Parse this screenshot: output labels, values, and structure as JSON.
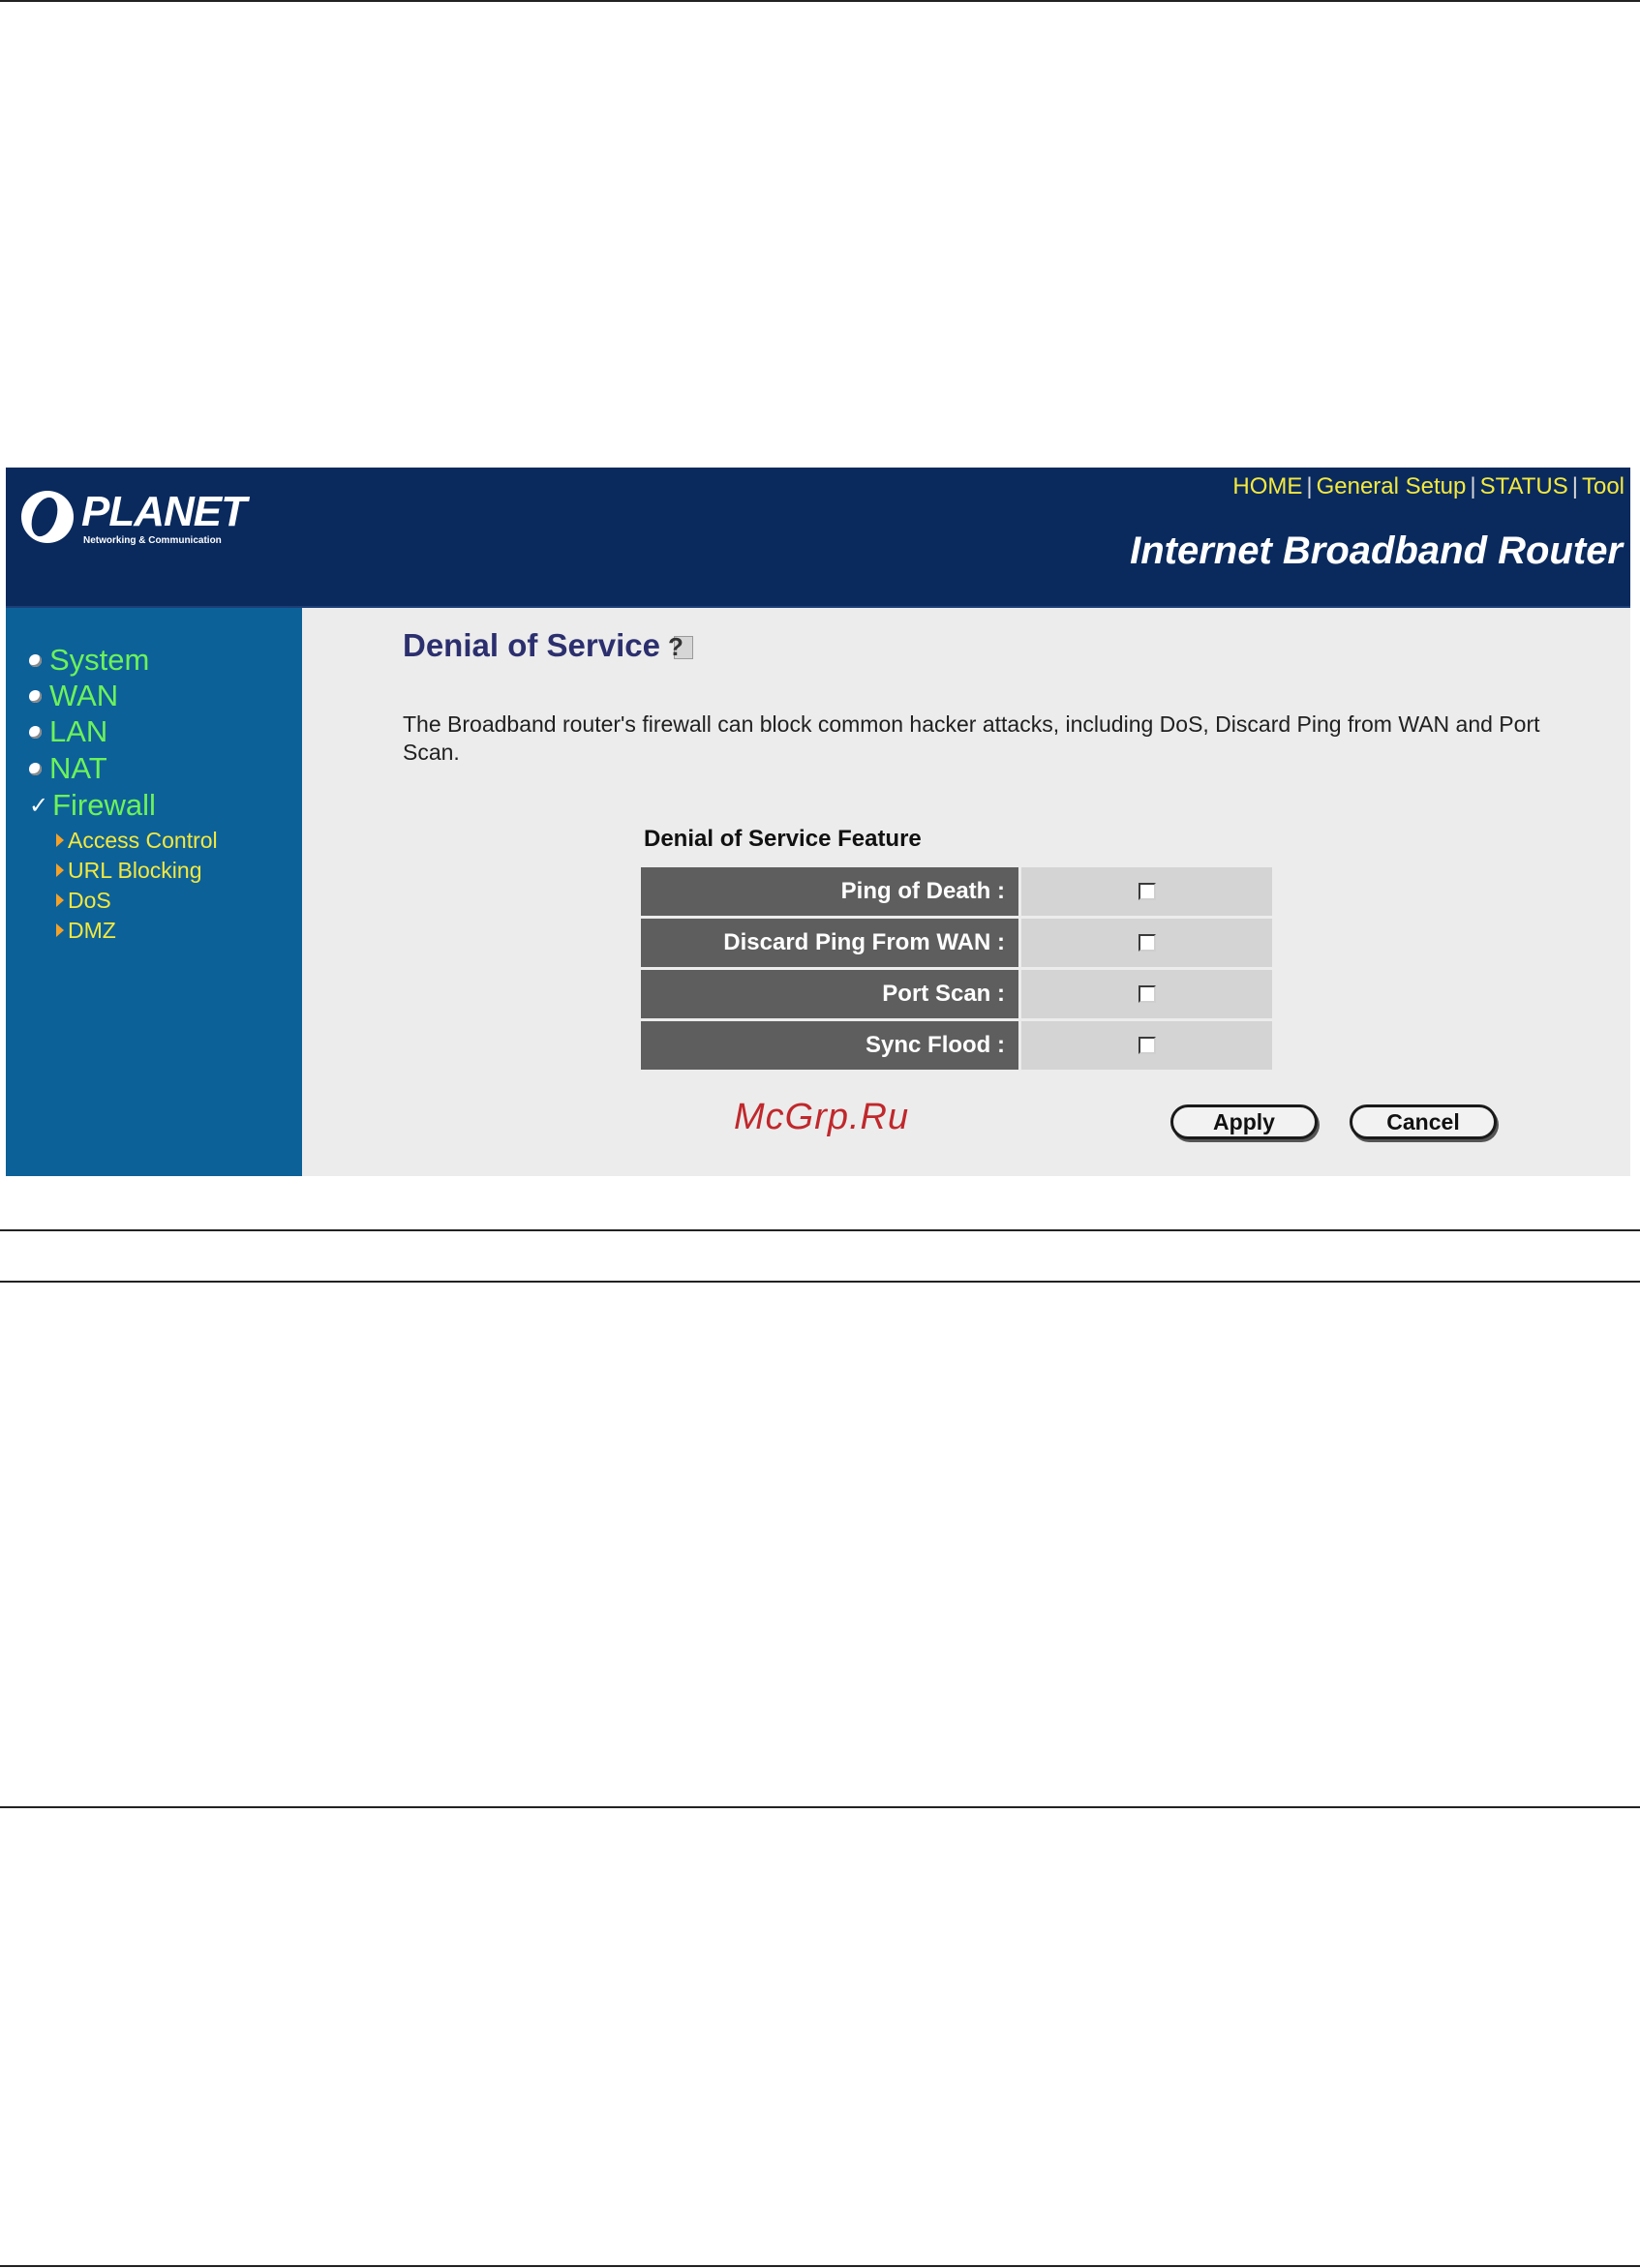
{
  "header": {
    "logo_name": "PLANET",
    "logo_tagline": "Networking & Communication",
    "nav": [
      "HOME",
      "General Setup",
      "STATUS",
      "Tool"
    ],
    "nav_separator": "|",
    "title": "Internet Broadband Router"
  },
  "sidebar": {
    "items": [
      {
        "label": "System",
        "icon": "bullet-icon"
      },
      {
        "label": "WAN",
        "icon": "bullet-icon"
      },
      {
        "label": "LAN",
        "icon": "bullet-icon"
      },
      {
        "label": "NAT",
        "icon": "bullet-icon"
      },
      {
        "label": "Firewall",
        "icon": "checkmark-icon",
        "active": true
      }
    ],
    "subitems": [
      "Access Control",
      "URL Blocking",
      "DoS",
      "DMZ"
    ]
  },
  "main": {
    "title": "Denial of Service",
    "description": "The Broadband router's firewall can block common hacker attacks, including DoS, Discard Ping from WAN and Port Scan.",
    "feature_title": "Denial of Service Feature",
    "features": [
      {
        "label": "Ping of Death :",
        "checked": false
      },
      {
        "label": "Discard Ping From WAN :",
        "checked": false
      },
      {
        "label": "Port Scan :",
        "checked": false
      },
      {
        "label": "Sync Flood :",
        "checked": false
      }
    ],
    "apply_label": "Apply",
    "cancel_label": "Cancel"
  },
  "watermark": "McGrp.Ru",
  "colors": {
    "header_bg": "#0a2a5e",
    "sidebar_bg": "#0d6199",
    "nav_link": "#f4e93d",
    "menu_text": "#6cf25a",
    "title_text": "#2c2f6e",
    "feature_label_bg": "#5e5e5e",
    "watermark": "#c0282c"
  }
}
